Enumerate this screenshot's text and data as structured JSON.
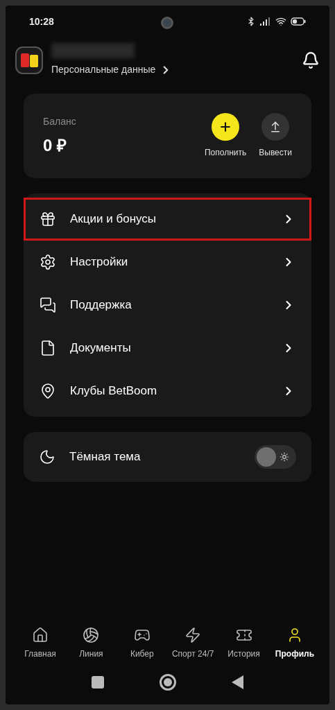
{
  "status_bar": {
    "time": "10:28"
  },
  "profile": {
    "link": "Персональные данные"
  },
  "balance": {
    "label": "Баланс",
    "amount": "0 ₽",
    "actions": [
      {
        "kind": "deposit",
        "label": "Пополнить"
      },
      {
        "kind": "withdraw",
        "label": "Вывести"
      }
    ]
  },
  "menu": [
    {
      "kind": "gift",
      "label": "Акции и бонусы",
      "highlighted": true
    },
    {
      "kind": "settings",
      "label": "Настройки",
      "highlighted": false
    },
    {
      "kind": "support",
      "label": "Поддержка",
      "highlighted": false
    },
    {
      "kind": "document",
      "label": "Документы",
      "highlighted": false
    },
    {
      "kind": "location",
      "label": "Клубы BetBoom",
      "highlighted": false
    }
  ],
  "theme": {
    "label": "Тёмная тема",
    "on": false
  },
  "tabs": [
    {
      "kind": "home",
      "label": "Главная",
      "selected": false
    },
    {
      "kind": "line",
      "label": "Линия",
      "selected": false
    },
    {
      "kind": "cyber",
      "label": "Кибер",
      "selected": false
    },
    {
      "kind": "sport",
      "label": "Спорт 24/7",
      "selected": false
    },
    {
      "kind": "history",
      "label": "История",
      "selected": false
    },
    {
      "kind": "profile",
      "label": "Профиль",
      "selected": true
    }
  ]
}
